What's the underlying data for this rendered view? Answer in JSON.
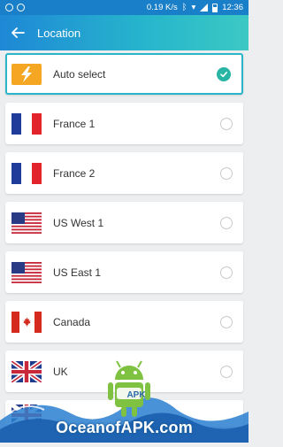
{
  "status_bar": {
    "speed": "0.19 K/s",
    "time": "12:36"
  },
  "app_bar": {
    "title": "Location"
  },
  "locations": [
    {
      "label": "Auto select",
      "flag": "lightning-bolt",
      "selected": true
    },
    {
      "label": "France 1",
      "flag": "france",
      "selected": false
    },
    {
      "label": "France 2",
      "flag": "france",
      "selected": false
    },
    {
      "label": "US West 1",
      "flag": "usa",
      "selected": false
    },
    {
      "label": "US East 1",
      "flag": "usa",
      "selected": false
    },
    {
      "label": "Canada",
      "flag": "canada",
      "selected": false
    },
    {
      "label": "UK",
      "flag": "uk",
      "selected": false
    }
  ],
  "watermark": {
    "brand": "APK",
    "text": "OceanofAPK.com"
  },
  "colors": {
    "accent": "#29b6c8",
    "check": "#28b5a3",
    "bolt": "#f5a623",
    "statusbar": "#1a7fc9"
  }
}
